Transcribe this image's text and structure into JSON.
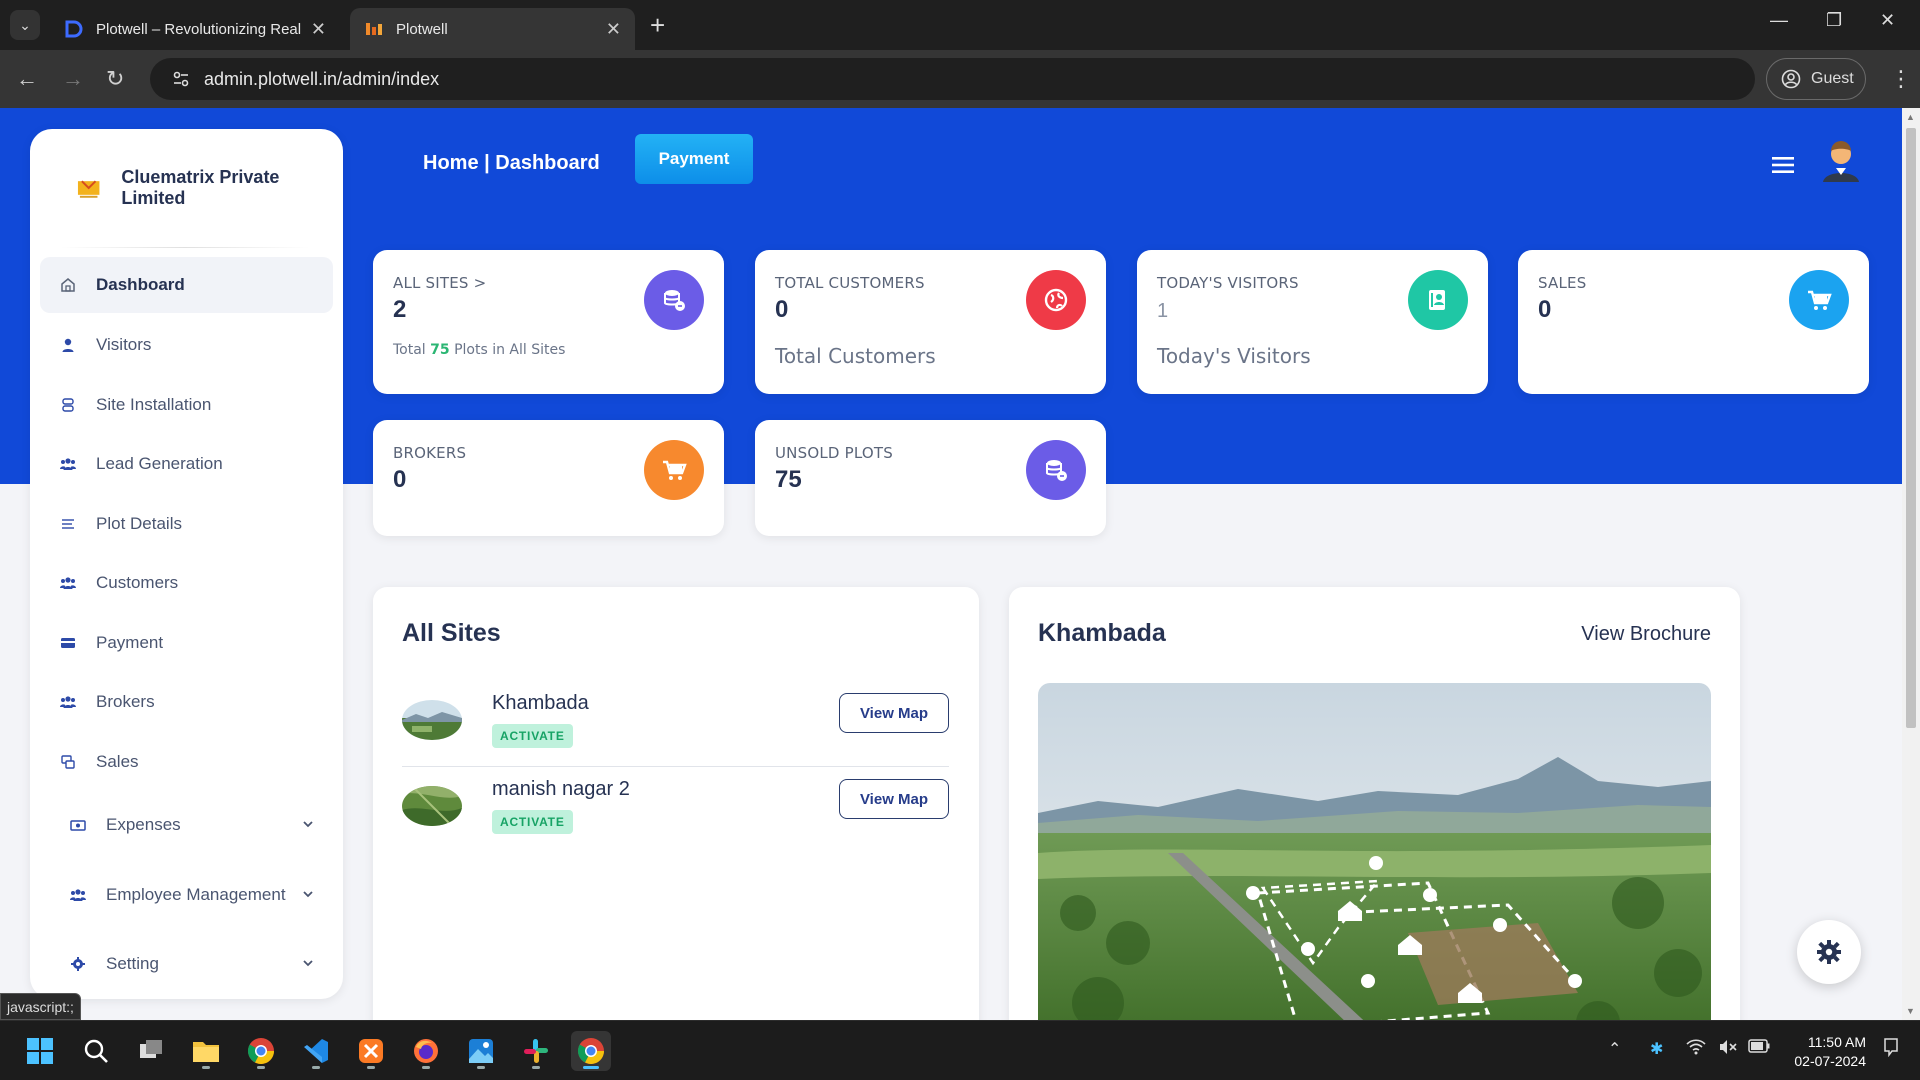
{
  "browser": {
    "tabs": [
      {
        "title": "Plotwell – Revolutionizing Real E",
        "active": false
      },
      {
        "title": "Plotwell",
        "active": true
      }
    ],
    "url": "admin.plotwell.in/admin/index",
    "profile_label": "Guest"
  },
  "sidebar": {
    "company": "Cluematrix Private Limited",
    "items": [
      {
        "label": "Dashboard",
        "icon": "home-icon",
        "active": true
      },
      {
        "label": "Visitors",
        "icon": "user-icon"
      },
      {
        "label": "Site Installation",
        "icon": "layers-icon"
      },
      {
        "label": "Lead Generation",
        "icon": "users-icon"
      },
      {
        "label": "Plot Details",
        "icon": "list-icon"
      },
      {
        "label": "Customers",
        "icon": "users-icon"
      },
      {
        "label": "Payment",
        "icon": "credit-card-icon"
      },
      {
        "label": "Brokers",
        "icon": "users-icon"
      },
      {
        "label": "Sales",
        "icon": "sales-icon"
      },
      {
        "label": "Expenses",
        "icon": "money-icon",
        "expandable": true
      },
      {
        "label": "Employee Management",
        "icon": "users-icon",
        "expandable": true
      },
      {
        "label": "Setting",
        "icon": "gear-icon",
        "expandable": true
      }
    ]
  },
  "header": {
    "title": "Home | Dashboard",
    "payment_button": "Payment"
  },
  "stats": [
    {
      "label": "ALL SITES >",
      "value": "2",
      "note_prefix": "Total ",
      "note_value": "75",
      "note_suffix": " Plots in All Sites",
      "color": "#6b5ce7",
      "icon": "database-icon"
    },
    {
      "label": "TOTAL CUSTOMERS",
      "value": "0",
      "description": "Total Customers",
      "color": "#ef3a47",
      "icon": "globe-icon"
    },
    {
      "label": "TODAY'S VISITORS",
      "value": "1",
      "description": "Today's Visitors",
      "color": "#1fc7a5",
      "icon": "visitor-icon"
    },
    {
      "label": "SALES",
      "value": "0",
      "color": "#1ba3f0",
      "icon": "cart-icon"
    },
    {
      "label": "BROKERS",
      "value": "0",
      "color": "#f7892e",
      "icon": "cart-icon"
    },
    {
      "label": "UNSOLD PLOTS",
      "value": "75",
      "color": "#6b5ce7",
      "icon": "database-icon"
    }
  ],
  "all_sites": {
    "title": "All Sites",
    "sites": [
      {
        "name": "Khambada",
        "status": "ACTIVATE",
        "action": "View Map"
      },
      {
        "name": "manish nagar 2",
        "status": "ACTIVATE",
        "action": "View Map"
      }
    ]
  },
  "site_detail": {
    "title": "Khambada",
    "brochure_link": "View Brochure"
  },
  "status_bar": "javascript:;",
  "taskbar": {
    "time": "11:50 AM",
    "date": "02-07-2024"
  }
}
